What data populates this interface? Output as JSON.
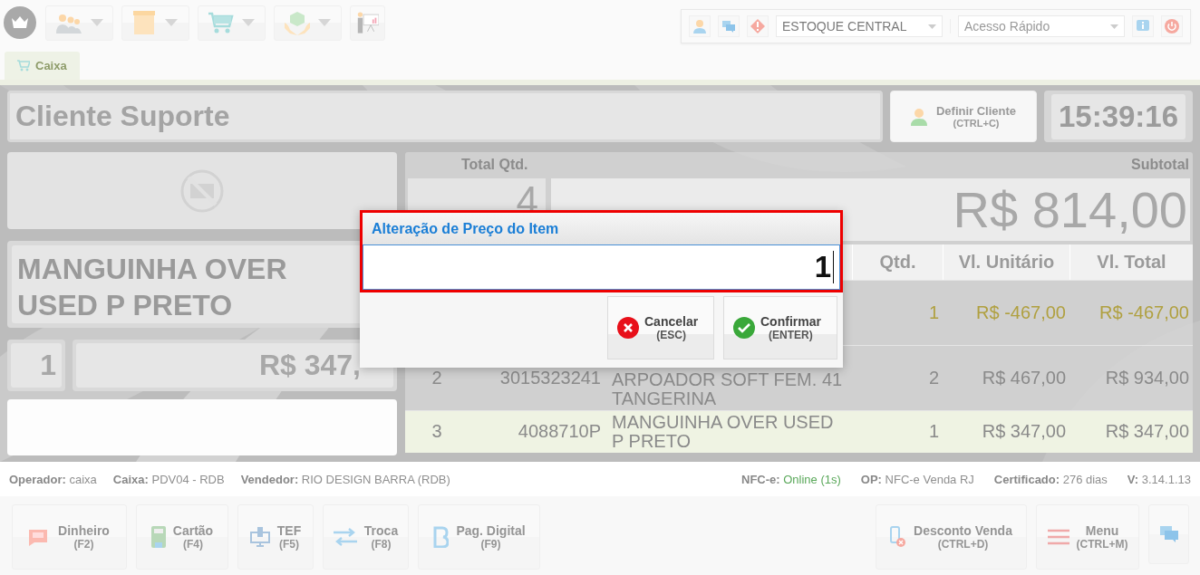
{
  "header": {
    "stock_select": {
      "value": "ESTOQUE CENTRAL"
    },
    "quick_access": {
      "placeholder": "Acesso Rápido"
    }
  },
  "tabs": [
    {
      "label": "Caixa",
      "selected": true
    }
  ],
  "client": {
    "name": "Cliente Suporte"
  },
  "define_client_button": {
    "label": "Definir Cliente",
    "shortcut": "(CTRL+C)"
  },
  "clock": "15:39:16",
  "current_item": {
    "name": "MANGUINHA OVER USED P PRETO",
    "quantity": "1",
    "price": "R$ 347,"
  },
  "summary": {
    "total_qty_label": "Total Qtd.",
    "total_qty": "4",
    "subtotal_label": "Subtotal",
    "subtotal": "R$ 814,00"
  },
  "table": {
    "columns": [
      "Qtd.",
      "Vl. Unitário",
      "Vl. Total"
    ],
    "rows": [
      {
        "kind": "return",
        "selected": false,
        "quantity": "1",
        "unit_price": "R$ -467,00",
        "total": "R$ -467,00"
      },
      {
        "kind": "sale",
        "selected": false,
        "number": "2",
        "code": "3015323241",
        "description": "ARPOADOR SOFT FEM. 41 TANGERINA",
        "quantity": "2",
        "unit_price": "R$ 467,00",
        "total": "R$ 934,00"
      },
      {
        "kind": "sale",
        "selected": true,
        "number": "3",
        "code": "4088710P",
        "description": "MANGUINHA OVER USED P PRETO",
        "quantity": "1",
        "unit_price": "R$ 347,00",
        "total": "R$ 347,00"
      }
    ]
  },
  "dialog": {
    "title": "Alteração de Preço do Item",
    "value": "1",
    "buttons": [
      {
        "label": "Cancelar",
        "shortcut": "(ESC)"
      },
      {
        "label": "Confirmar",
        "shortcut": "(ENTER)"
      }
    ]
  },
  "status_bar": {
    "left": [
      {
        "label": "Operador:",
        "value": "caixa"
      },
      {
        "label": "Caixa:",
        "value": "PDV04 - RDB"
      },
      {
        "label": "Vendedor:",
        "value": "RIO DESIGN BARRA (RDB)"
      }
    ],
    "right": [
      {
        "label": "NFC-e:",
        "value": "Online (1s)",
        "online": true
      },
      {
        "label": "OP:",
        "value": "NFC-e Venda RJ"
      },
      {
        "label": "Certificado:",
        "value": "276 dias"
      },
      {
        "label": "V:",
        "value": "3.14.1.13"
      }
    ]
  },
  "payment_buttons": [
    {
      "label": "Dinheiro",
      "shortcut": "(F2)"
    },
    {
      "label": "Cartão",
      "shortcut": "(F4)"
    },
    {
      "label": "TEF",
      "shortcut": "(F5)"
    },
    {
      "label": "Troca",
      "shortcut": "(F8)"
    },
    {
      "label": "Pag. Digital",
      "shortcut": "(F9)"
    }
  ],
  "action_buttons": [
    {
      "label": "Desconto Venda",
      "shortcut": "(CTRL+D)"
    },
    {
      "label": "Menu",
      "shortcut": "(CTRL+M)"
    }
  ]
}
